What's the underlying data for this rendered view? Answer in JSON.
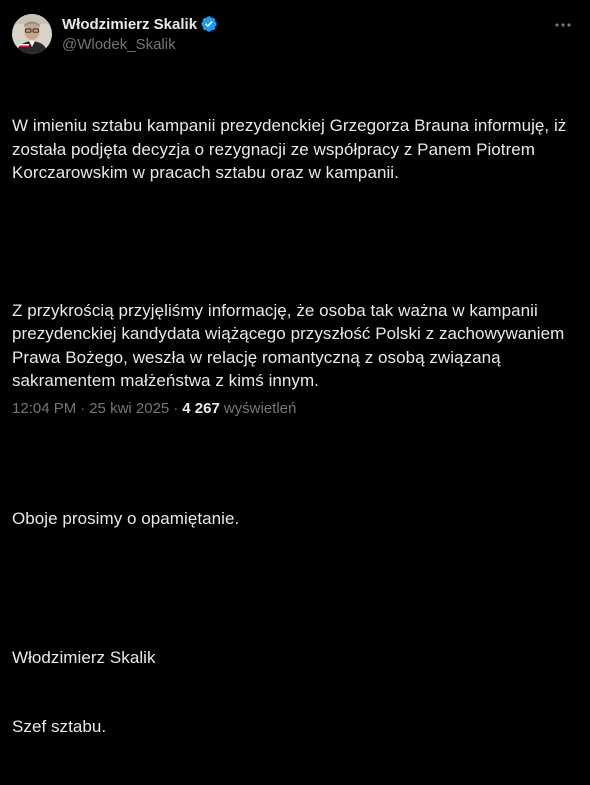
{
  "author": {
    "display_name": "Włodzimierz Skalik",
    "handle": "@Wlodek_Skalik",
    "verified": true,
    "verified_color": "#1d9bf0"
  },
  "post": {
    "paragraphs": [
      "W imieniu sztabu kampanii prezydenckiej Grzegorza Brauna informuję, iż została podjęta decyzja o rezygnacji ze współpracy z Panem Piotrem Korczarowskim w pracach sztabu oraz w kampanii.",
      "Z przykrością przyjęliśmy informację, że osoba tak ważna w kampanii prezydenckiej kandydata wiążącego przyszłość Polski z zachowywaniem Prawa Bożego, weszła w relację romantyczną z osobą związaną sakramentem małżeństwa z kimś innym.",
      "Oboje prosimy o opamiętanie.",
      "Włodzimierz Skalik",
      "Szef sztabu."
    ]
  },
  "meta": {
    "time": "12:04 PM",
    "separator": "·",
    "date": "25 kwi 2025",
    "views_count": "4 267",
    "views_label": "wyświetleń"
  },
  "icons": {
    "more": "more-options-icon",
    "verified": "verified-badge-icon",
    "avatar": "profile-avatar"
  },
  "colors": {
    "background": "#000000",
    "primary_text": "#e7e9ea",
    "secondary_text": "#71767b"
  }
}
